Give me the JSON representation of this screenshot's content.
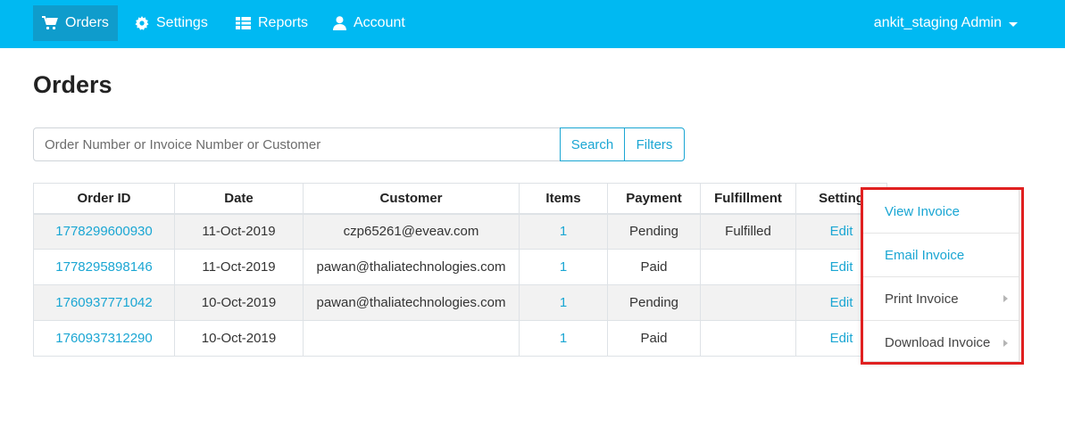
{
  "nav": {
    "items": [
      {
        "label": "Orders",
        "icon": "cart-icon",
        "active": true
      },
      {
        "label": "Settings",
        "icon": "gear-icon",
        "active": false
      },
      {
        "label": "Reports",
        "icon": "table-icon",
        "active": false
      },
      {
        "label": "Account",
        "icon": "user-icon",
        "active": false
      }
    ],
    "user_label": "ankit_staging Admin"
  },
  "page": {
    "title": "Orders"
  },
  "search": {
    "placeholder": "Order Number or Invoice Number or Customer",
    "search_label": "Search",
    "filters_label": "Filters"
  },
  "table": {
    "headers": [
      "Order ID",
      "Date",
      "Customer",
      "Items",
      "Payment",
      "Fulfillment",
      "Setting"
    ],
    "rows": [
      {
        "order_id": "1778299600930",
        "date": "11-Oct-2019",
        "customer": "czp65261@eveav.com",
        "items": "1",
        "payment": "Pending",
        "fulfillment": "Fulfilled",
        "setting": "Edit"
      },
      {
        "order_id": "1778295898146",
        "date": "11-Oct-2019",
        "customer": "pawan@thaliatechnologies.com",
        "items": "1",
        "payment": "Paid",
        "fulfillment": "",
        "setting": "Edit"
      },
      {
        "order_id": "1760937771042",
        "date": "10-Oct-2019",
        "customer": "pawan@thaliatechnologies.com",
        "items": "1",
        "payment": "Pending",
        "fulfillment": "",
        "setting": "Edit"
      },
      {
        "order_id": "1760937312290",
        "date": "10-Oct-2019",
        "customer": "",
        "items": "1",
        "payment": "Paid",
        "fulfillment": "",
        "setting": "Edit"
      }
    ]
  },
  "dropdown": {
    "items": [
      {
        "label": "View Invoice",
        "submenu": false
      },
      {
        "label": "Email Invoice",
        "submenu": false
      },
      {
        "label": "Print Invoice",
        "submenu": true
      },
      {
        "label": "Download Invoice",
        "submenu": true
      }
    ]
  },
  "colors": {
    "navbar": "#00b9f2",
    "nav_active": "#0f9ccc",
    "link": "#1aa6d3",
    "highlight": "#e02020"
  }
}
